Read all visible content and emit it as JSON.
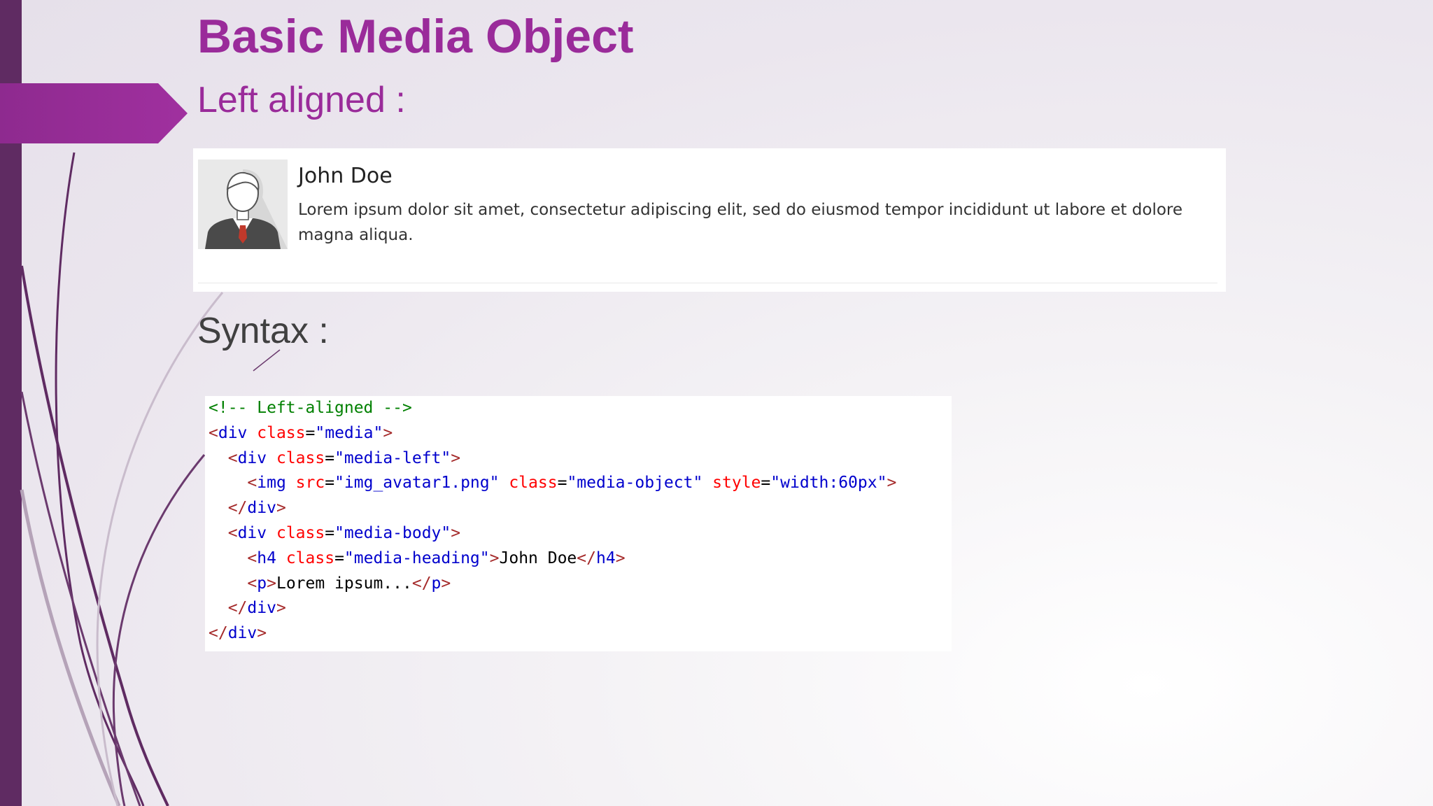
{
  "slide": {
    "title": "Basic Media Object",
    "subtitle": "Left aligned :",
    "syntax_heading": "Syntax :"
  },
  "demo": {
    "heading": "John Doe",
    "text": "Lorem ipsum dolor sit amet, consectetur adipiscing elit, sed do eiusmod tempor incididunt ut labore et dolore magna aliqua."
  },
  "code": {
    "line1": "<!-- Left-aligned -->",
    "line2_open": "<",
    "line2_tag": "div",
    "line2_attr": "class",
    "line2_eq": "=",
    "line2_val": "\"media\"",
    "line2_close": ">",
    "line3_indent": "  ",
    "line3_open": "<",
    "line3_tag": "div",
    "line3_attr": "class",
    "line3_eq": "=",
    "line3_val": "\"media-left\"",
    "line3_close": ">",
    "line4_indent": "    ",
    "line4_open": "<",
    "line4_tag": "img",
    "line4_attr1": "src",
    "line4_eq1": "=",
    "line4_val1": "\"img_avatar1.png\"",
    "line4_attr2": "class",
    "line4_eq2": "=",
    "line4_val2": "\"media-object\"",
    "line4_attr3": "style",
    "line4_eq3": "=",
    "line4_val3": "\"width:60px\"",
    "line4_close": ">",
    "line5_indent": "  ",
    "line5_open": "</",
    "line5_tag": "div",
    "line5_close": ">",
    "line6_indent": "  ",
    "line6_open": "<",
    "line6_tag": "div",
    "line6_attr": "class",
    "line6_eq": "=",
    "line6_val": "\"media-body\"",
    "line6_close": ">",
    "line7_indent": "    ",
    "line7_open": "<",
    "line7_tag": "h4",
    "line7_attr": "class",
    "line7_eq": "=",
    "line7_val": "\"media-heading\"",
    "line7_close": ">",
    "line7_text": "John Doe",
    "line7_end_open": "</",
    "line7_end_tag": "h4",
    "line7_end_close": ">",
    "line8_indent": "    ",
    "line8_open": "<",
    "line8_tag": "p",
    "line8_close": ">",
    "line8_text": "Lorem ipsum...",
    "line8_end_open": "</",
    "line8_end_tag": "p",
    "line8_end_close": ">",
    "line9_indent": "  ",
    "line9_open": "</",
    "line9_tag": "div",
    "line9_close": ">",
    "line10_open": "</",
    "line10_tag": "div",
    "line10_close": ">"
  },
  "colors": {
    "accent": "#9a2b9a",
    "sidebar": "#5f2b62",
    "comment": "#008000",
    "tag_name": "#0000cd",
    "attribute": "#ff0000",
    "value": "#0000cd"
  }
}
